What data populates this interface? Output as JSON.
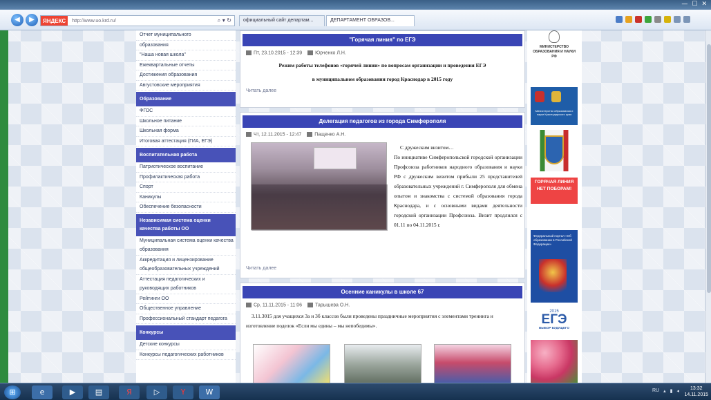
{
  "browser": {
    "address_brand": "ЯНДЕКС",
    "url": "http://www.uo.krd.ru/",
    "addr_tools": "⌕ ▾ ↻",
    "tabs": [
      {
        "label": "официальный сайт департам..."
      },
      {
        "label": "ДЕПАРТАМЕНТ ОБРАЗОВ..."
      }
    ],
    "window_controls": [
      "—",
      "☐",
      "✕"
    ]
  },
  "sidebar": {
    "top_items": [
      "Отчет муниципального",
      "образования",
      "\"Наша новая школа\"",
      "Ежеквартальные отчеты",
      "Достижения образования",
      "Августовские мероприятия"
    ],
    "sections": [
      {
        "title": "Образование",
        "items": [
          "ФГОС",
          "Школьное питание",
          "Школьная форма",
          "Итоговая аттестация (ГИА, ЕГЭ)"
        ]
      },
      {
        "title": "Воспитательная работа",
        "items": [
          "Патриотическое воспитание",
          "Профилактическая работа",
          "Спорт",
          "Каникулы",
          "Обеспечение безопасности"
        ]
      },
      {
        "title": "Независимая система оценки качества работы ОО",
        "items": [
          "Муниципальная система оценки качества образования",
          "Аккредитация и лицензирование общеобразовательных учреждений",
          "Аттестация педагогических и руководящих работников",
          "Рейтинги ОО",
          "Общественное управление",
          "Профессиональный стандарт педагога"
        ]
      },
      {
        "title": "Конкурсы",
        "items": [
          "Детские конкурсы",
          "Конкурсы педагогических работников"
        ]
      }
    ]
  },
  "articles": [
    {
      "title": "\"Горячая линия\" по ЕГЭ",
      "date": "Пт, 23.10.2015 - 12:39",
      "author": "Юрченко Л.Н.",
      "body_line1": "Режим работы телефонов «горячей линии» по вопросам организации и проведения ЕГЭ",
      "body_line2": "в муниципальном образовании город Краснодар в 2015 году",
      "read_more": "Читать далее"
    },
    {
      "title": "Делегация педагогов из города Симферополя",
      "date": "Чт, 12.11.2015 - 12:47",
      "author": "Пащенко А.Н.",
      "intro": "С дружеским визитом…",
      "body": "По инициативе Симферопольской городской организации Профсоюза работников народного образования и науки РФ с дружеским визитом прибыли 25 представителей образовательных учреждений г. Симферополя для обмена опытом и знакомства с системой образования города Краснодара, и с основными видами деятельности городской организации Профсоюза. Визит продлился с 01.11 по 04.11.2015 г.",
      "read_more": "Читать далее"
    },
    {
      "title": "Осенние каникулы в школе 67",
      "date": "Ср, 11.11.2015 - 11:06",
      "author": "Тарышева О.Н.",
      "body": "3.11.3015 для учащихся 3а и 3б классов были проведены праздничные мероприятия с элементами тренинга и изготовление поделок «Если мы едины – мы непобедимы»."
    }
  ],
  "right_banners": {
    "ministry": "МИНИСТЕРСТВО ОБРАЗОВАНИЯ И НАУКИ РФ",
    "krasnodar_ministry": "Министерство образования и науки Краснодарского края",
    "hotline": "ГОРЯЧАЯ ЛИНИЯ НЕТ ПОБОРАМ!",
    "federal_portal": "Федеральный портал «Об образовании в Российской Федерации»",
    "ege": "ЕГЭ",
    "ege_year": "2015",
    "ege_sub": "ВЫБОР БУДУЩЕГО"
  },
  "taskbar": {
    "lang": "RU",
    "time": "13:32",
    "date": "14.11.2015"
  },
  "colors": {
    "nav_header": "#4852b8",
    "article_title": "#3a45b5",
    "accent_green": "#2e8b3e"
  }
}
